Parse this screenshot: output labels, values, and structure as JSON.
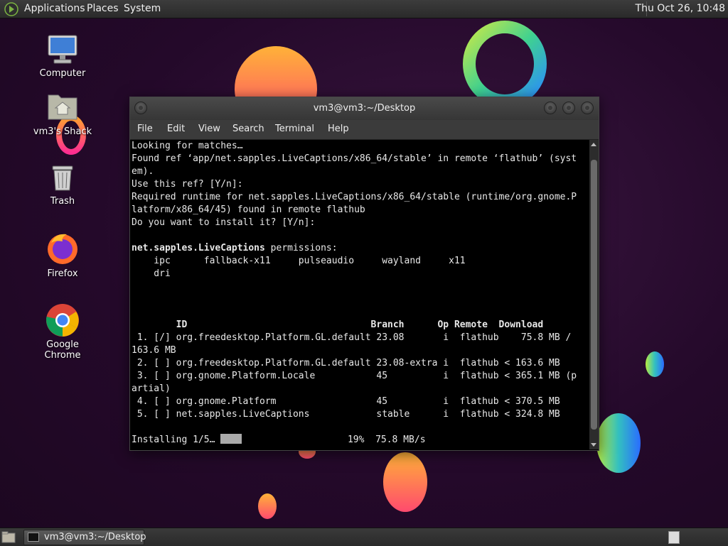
{
  "top_panel": {
    "menus": [
      "Applications",
      "Places",
      "System"
    ],
    "clock": "Thu Oct 26, 10:48"
  },
  "desktop_icons": [
    {
      "label": "Computer",
      "icon": "computer-icon"
    },
    {
      "label": "vm3's Shack",
      "icon": "home-folder-icon"
    },
    {
      "label": "Trash",
      "icon": "trash-icon"
    },
    {
      "label": "Firefox",
      "icon": "firefox-icon"
    },
    {
      "label": "Google Chrome",
      "icon": "chrome-icon"
    }
  ],
  "terminal": {
    "title": "vm3@vm3:~/Desktop",
    "menu": [
      "File",
      "Edit",
      "View",
      "Search",
      "Terminal",
      "Help"
    ],
    "lines": [
      "Looking for matches…",
      "Found ref ‘app/net.sapples.LiveCaptions/x86_64/stable’ in remote ‘flathub’ (syst",
      "em).",
      "Use this ref? [Y/n]:",
      "Required runtime for net.sapples.LiveCaptions/x86_64/stable (runtime/org.gnome.P",
      "latform/x86_64/45) found in remote flathub",
      "Do you want to install it? [Y/n]:",
      ""
    ],
    "perm_app": "net.sapples.LiveCaptions",
    "perm_suffix": " permissions:",
    "perm_lines": [
      "    ipc      fallback-x11     pulseaudio     wayland     x11",
      "    dri"
    ],
    "table_header": "        ID                                 Branch      Op Remote  Download",
    "table_rows": [
      " 1. [/] org.freedesktop.Platform.GL.default 23.08       i  flathub    75.8 MB /",
      "163.6 MB",
      " 2. [ ] org.freedesktop.Platform.GL.default 23.08-extra i  flathub < 163.6 MB",
      " 3. [ ] org.gnome.Platform.Locale           45          i  flathub < 365.1 MB (p",
      "artial)",
      " 4. [ ] org.gnome.Platform                  45          i  flathub < 370.5 MB",
      " 5. [ ] net.sapples.LiveCaptions            stable      i  flathub < 324.8 MB"
    ],
    "progress_prefix": "Installing 1/5… ",
    "progress_suffix": "                   19%  75.8 MB/s"
  },
  "taskbar": {
    "window_button": "vm3@vm3:~/Desktop"
  },
  "colors": {
    "desktop_bg": "#2b1130",
    "panel": "#333333",
    "terminal_bg": "#000000",
    "terminal_fg": "#e8e8e8"
  }
}
